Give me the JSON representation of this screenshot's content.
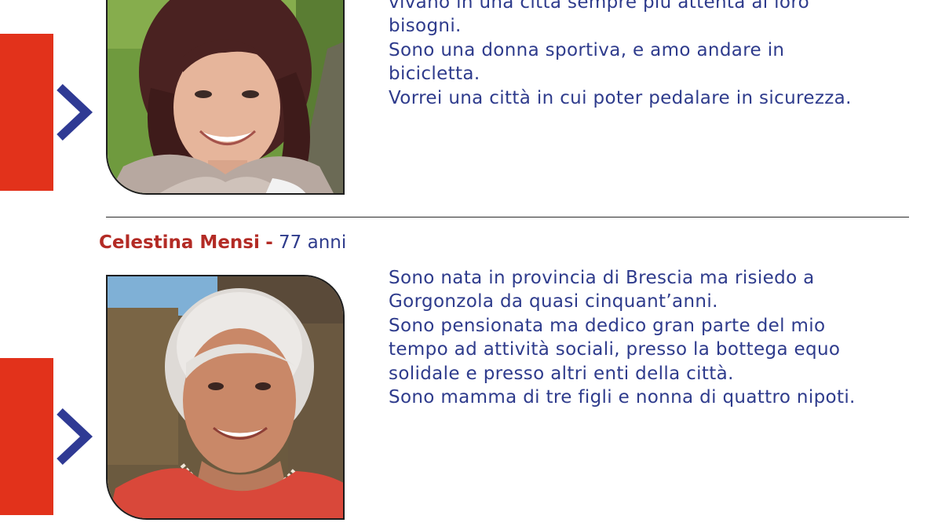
{
  "profile_1": {
    "bio_lines": [
      "vivano in una città sempre più attenta ai loro",
      "bisogni.",
      "Sono una donna sportiva, e amo andare in",
      "bicicletta.",
      "Vorrei una città in cui poter pedalare in sicurezza."
    ]
  },
  "profile_2": {
    "name": "Celestina Mensi",
    "separator": "-",
    "age": "77 anni",
    "bio_lines": [
      "Sono nata in provincia di Brescia ma risiedo a",
      "Gorgonzola da quasi cinquant’anni.",
      "Sono pensionata ma dedico gran parte del mio",
      "tempo ad attività sociali, presso la bottega equo",
      "solidale e presso altri enti della città.",
      "Sono mamma di tre figli e nonna di quattro nipoti."
    ]
  },
  "colors": {
    "accent_red": "#e2321b",
    "name_red": "#b32b25",
    "text_blue": "#2e3b8c",
    "chevron_blue": "#2f3a94"
  },
  "icons": [
    "chevron-right-icon"
  ]
}
